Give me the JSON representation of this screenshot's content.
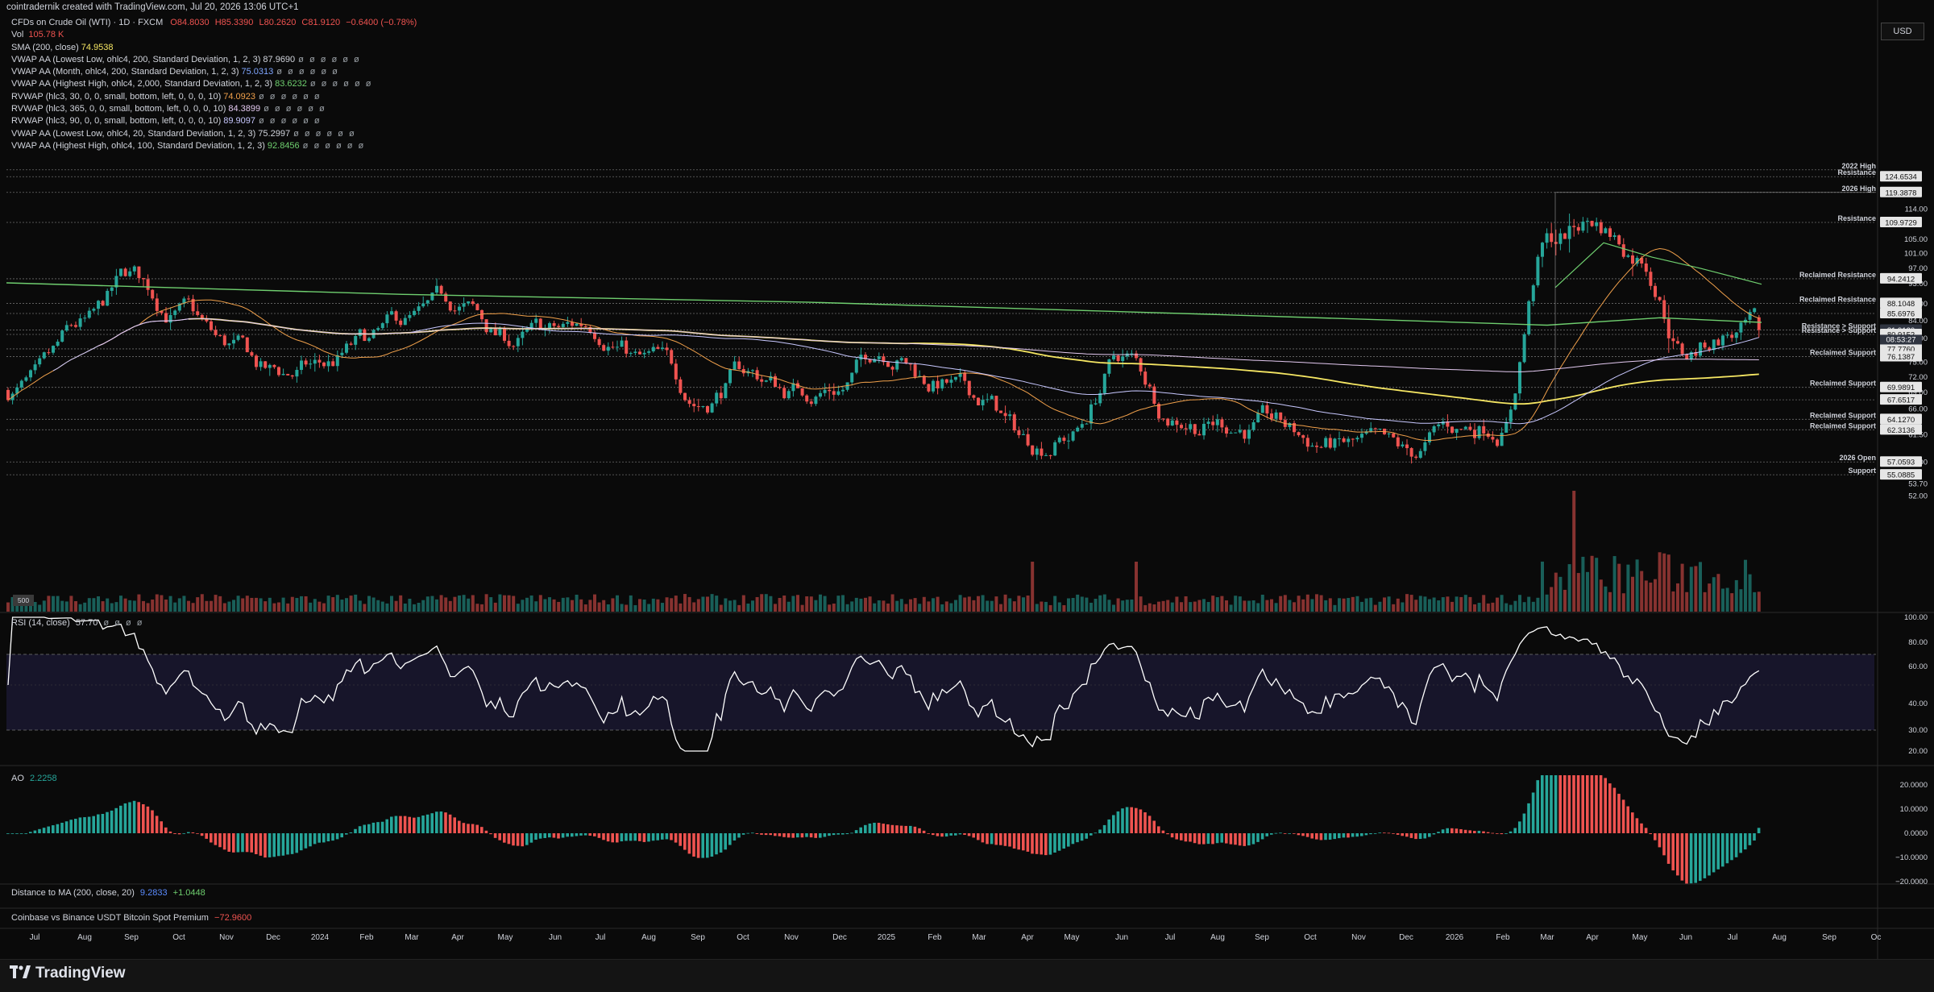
{
  "header": {
    "creator": "cointradernik created with TradingView.com, Jul 20, 2026 13:06 UTC+1"
  },
  "ohlc": {
    "symbol": "CFDs on Crude Oil (WTI) · 1D · FXCM",
    "o": "O84.8030",
    "h": "H85.3390",
    "l": "L80.2620",
    "c": "C81.9120",
    "chg": "−0.6400 (−0.78%)"
  },
  "volume": {
    "label": "Vol",
    "value": "105.78 K",
    "badge": "500"
  },
  "indicators": [
    {
      "name": "SMA (200, close)",
      "value": "74.9538",
      "color": "#f5e663",
      "dots": ""
    },
    {
      "name": "VWAP AA (Lowest Low, ohlc4, 200, Standard Deviation, 1, 2, 3)",
      "value": "87.9690",
      "color": "#d1d4dc",
      "dots": "ø ø ø ø ø ø"
    },
    {
      "name": "VWAP AA (Month, ohlc4, 200, Standard Deviation, 1, 2, 3)",
      "value": "75.0313",
      "color": "#7fa6ff",
      "dots": "ø ø ø ø ø ø"
    },
    {
      "name": "VWAP AA (Highest High, ohlc4, 2,000, Standard Deviation, 1, 2, 3)",
      "value": "83.6232",
      "color": "#6fcf6f",
      "dots": "ø ø ø ø ø ø"
    },
    {
      "name": "RVWAP (hlc3, 30, 0, 0, small, bottom, left, 0, 0, 0, 10)",
      "value": "74.0923",
      "color": "#f0a04b",
      "dots": "ø ø ø ø ø ø"
    },
    {
      "name": "RVWAP (hlc3, 365, 0, 0, small, bottom, left, 0, 0, 0, 10)",
      "value": "84.3899",
      "color": "#e3c9f0",
      "dots": "ø ø ø ø ø ø"
    },
    {
      "name": "RVWAP (hlc3, 90, 0, 0, small, bottom, left, 0, 0, 0, 10)",
      "value": "89.9097",
      "color": "#c8c8ff",
      "dots": "ø ø ø ø ø ø"
    },
    {
      "name": "VWAP AA (Lowest Low, ohlc4, 20, Standard Deviation, 1, 2, 3)",
      "value": "75.2997",
      "color": "#d1d4dc",
      "dots": "ø ø ø ø ø ø"
    },
    {
      "name": "VWAP AA (Highest High, ohlc4, 100, Standard Deviation, 1, 2, 3)",
      "value": "92.8456",
      "color": "#6fcf6f",
      "dots": "ø ø ø ø ø ø"
    }
  ],
  "rsi_legend": {
    "label": "RSI (14, close)",
    "value": "57.70",
    "dots": "ø ø ø ø"
  },
  "ao_legend": {
    "label": "AO",
    "value": "2.2258"
  },
  "dist_legend": {
    "label": "Distance to MA (200, close, 20)",
    "v1": "9.2833",
    "v2": "+1.0448"
  },
  "premium_legend": {
    "label": "Coinbase vs Binance USDT Bitcoin Spot Premium",
    "value": "−72.9600"
  },
  "currency_button": "USD",
  "brand": "TradingView",
  "colors": {
    "up": "#26a69a",
    "down": "#ef5350",
    "background": "#0a0a0a",
    "sma200": "#f5e663",
    "vwap_hh": "#6fcf6f",
    "rvwap30": "#f0a04b",
    "rvwap365": "#e3c9f0",
    "rvwap90": "#c8c8ff",
    "rsi_band": "#1a1830",
    "level_line": "#bdbdbd"
  },
  "chart_data": [
    {
      "type": "candlestick",
      "title": "CFDs on Crude Oil (WTI) · 1D · FXCM",
      "xlabel": "",
      "ylabel": "",
      "x_ticks": [
        "Jul",
        "Aug",
        "Sep",
        "Oct",
        "Nov",
        "Dec",
        "2024",
        "Feb",
        "Mar",
        "Apr",
        "May",
        "Jun",
        "Jul",
        "Aug",
        "Sep",
        "Oct",
        "Nov",
        "Dec",
        "2025",
        "Feb",
        "Mar",
        "Apr",
        "May",
        "Jun",
        "Jul",
        "Aug",
        "Sep",
        "Oct",
        "Nov",
        "Dec",
        "2026",
        "Feb",
        "Mar",
        "Apr",
        "May",
        "Jun",
        "Jul",
        "Aug",
        "Sep",
        "Oc"
      ],
      "y_ticks": [
        52.0,
        53.7,
        57.0,
        61.5,
        66.0,
        69.0,
        72.0,
        75.0,
        80.0,
        84.0,
        88.0,
        93.0,
        97.0,
        101.0,
        105.0,
        114.0
      ],
      "ylim": [
        50.8,
        127
      ],
      "price_path_monthly": [
        [
          "Jul",
          70.0
        ],
        [
          "Aug",
          80.0
        ],
        [
          "Sep",
          92.0
        ],
        [
          "Oct",
          86.0
        ],
        [
          "Nov",
          77.0
        ],
        [
          "Dec",
          71.5
        ],
        [
          "2024",
          73.0
        ],
        [
          "Feb",
          77.5
        ],
        [
          "Mar",
          82.0
        ],
        [
          "Apr",
          86.0
        ],
        [
          "May",
          79.0
        ],
        [
          "Jun",
          80.0
        ],
        [
          "Jul",
          83.0
        ],
        [
          "Aug",
          75.0
        ],
        [
          "Sep",
          68.0
        ],
        [
          "Oct",
          73.0
        ],
        [
          "Nov",
          69.5
        ],
        [
          "Dec",
          71.0
        ],
        [
          "2025",
          79.0
        ],
        [
          "Feb",
          72.0
        ],
        [
          "Mar",
          67.5
        ],
        [
          "Apr",
          60.0
        ],
        [
          "May",
          62.0
        ],
        [
          "Jun",
          76.0
        ],
        [
          "Jul",
          66.0
        ],
        [
          "Aug",
          64.5
        ],
        [
          "Sep",
          63.5
        ],
        [
          "Oct",
          60.0
        ],
        [
          "Nov",
          59.0
        ],
        [
          "Dec",
          56.0
        ],
        [
          "2026",
          61.5
        ],
        [
          "Feb",
          64.0
        ],
        [
          "Mar",
          104.0
        ],
        [
          "Apr",
          110.0
        ],
        [
          "May",
          102.0
        ],
        [
          "Jun",
          78.0
        ],
        [
          "Jul",
          81.9
        ]
      ],
      "last_price": 81.912,
      "countdown": "08:53:27",
      "levels": [
        {
          "label": "2022 High",
          "value": 127.0
        },
        {
          "label": "Resistance",
          "value": 124.6534
        },
        {
          "label": "2026 High",
          "value": 119.3878
        },
        {
          "label": "Resistance",
          "value": 109.9729
        },
        {
          "label": "Reclaimed Resistance",
          "value": 94.2412
        },
        {
          "label": "Reclaimed Resistance",
          "value": 88.1048
        },
        {
          "label": "",
          "value": 85.6976
        },
        {
          "label": "Resistance > Support",
          "value": 81.912
        },
        {
          "label": "Resistance > Support",
          "value": 80.9152
        },
        {
          "label": "",
          "value": 77.776
        },
        {
          "label": "Reclaimed Support",
          "value": 76.1387
        },
        {
          "label": "Reclaimed Support",
          "value": 69.9891
        },
        {
          "label": "",
          "value": 67.6517
        },
        {
          "label": "Reclaimed Support",
          "value": 64.127
        },
        {
          "label": "Reclaimed Support",
          "value": 62.3136
        },
        {
          "label": "2026 Open",
          "value": 57.0593
        },
        {
          "label": "Support",
          "value": 55.0885
        }
      ],
      "series": [
        {
          "name": "SMA (200, close)",
          "last": 74.9538
        },
        {
          "name": "VWAP AA (Highest High, ohlc4, 2,000, Standard Deviation, 1, 2, 3)",
          "last": 83.6232
        },
        {
          "name": "RVWAP (hlc3, 30, 0, 0, small, bottom, left, 0, 0, 0, 10)",
          "last": 74.0923
        },
        {
          "name": "RVWAP (hlc3, 365, 0, 0, small, bottom, left, 0, 0, 0, 10)",
          "last": 84.3899
        },
        {
          "name": "RVWAP (hlc3, 90, 0, 0, small, bottom, left, 0, 0, 0, 10)",
          "last": 89.9097
        },
        {
          "name": "VWAP AA (Highest High, ohlc4, 100, Standard Deviation, 1, 2, 3)",
          "last": 92.8456
        }
      ]
    },
    {
      "type": "line",
      "title": "RSI (14, close)",
      "y_ticks": [
        100.0,
        80.0,
        60.0,
        40.0,
        30.0,
        20.0
      ],
      "ylim": [
        20,
        100
      ],
      "band": [
        30,
        70
      ],
      "series": [
        {
          "name": "RSI (14, close)",
          "last": 57.7
        }
      ]
    },
    {
      "type": "bar",
      "title": "AO",
      "y_ticks": [
        20.0,
        10.0,
        0.0,
        -10.0,
        -20.0
      ],
      "ylim": [
        -23,
        24
      ],
      "series": [
        {
          "name": "AO",
          "last": 2.2258
        }
      ]
    }
  ]
}
